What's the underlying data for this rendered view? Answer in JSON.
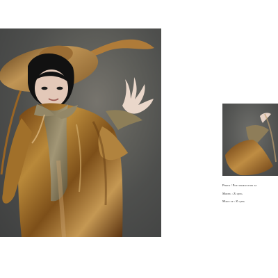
{
  "layout": {
    "page_background": "#ffffff",
    "main_photo_tones": {
      "background": "#55524d",
      "coat": "#9a6a1f",
      "hat": "#b7863f",
      "scarf": "#85785a",
      "skin": "#e7d2c2",
      "hair": "#111111"
    }
  },
  "images": {
    "main_photo": {
      "icon": "fashion-portrait-photo"
    },
    "thumbnail_photo": {
      "icon": "fashion-detail-photo"
    }
  },
  "caption": {
    "photo_line": "Photo / Post production at",
    "model_line": "Model : Zi qing",
    "makeup_line": "Make up : Zi qing"
  }
}
